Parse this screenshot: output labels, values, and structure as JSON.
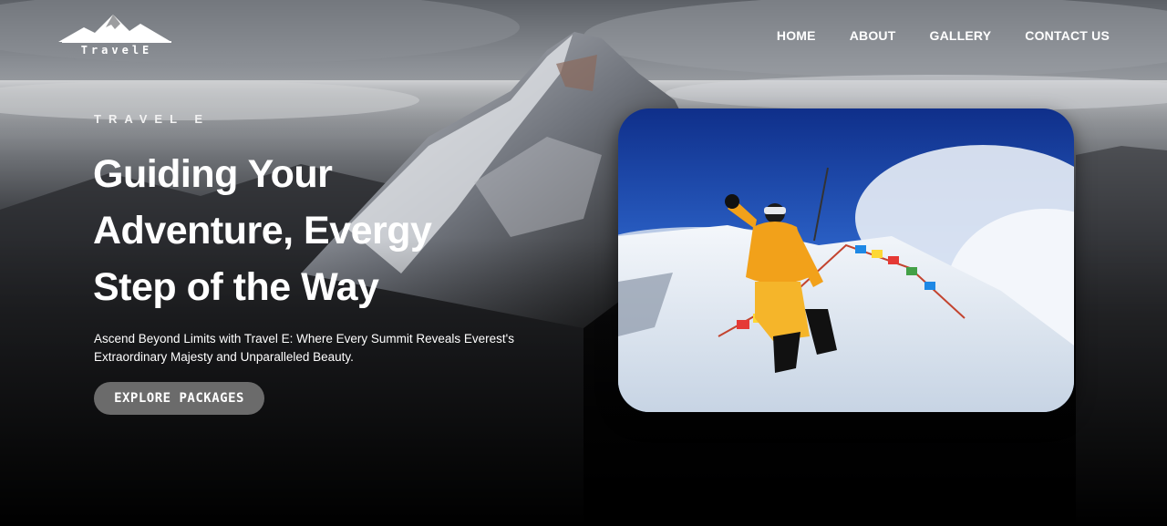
{
  "brand": {
    "logo_text": "TravelE"
  },
  "nav": {
    "items": [
      {
        "label": "HOME"
      },
      {
        "label": "ABOUT"
      },
      {
        "label": "GALLERY"
      },
      {
        "label": "CONTACT US"
      }
    ]
  },
  "hero": {
    "eyebrow": "TRAVEL E",
    "headline_lines": [
      "Guiding Your",
      "Adventure, Evergy",
      "Step of the Way"
    ],
    "lead_lines": [
      "Ascend Beyond Limits with Travel E: Where Every Summit Reveals Everest's",
      "Extraordinary Majesty and Unparalleled Beauty."
    ],
    "cta_label": "EXPLORE  PACKAGES"
  },
  "images": {
    "background": "mountain-peak-above-clouds",
    "photo": "climber-on-summit-with-prayer-flags"
  }
}
